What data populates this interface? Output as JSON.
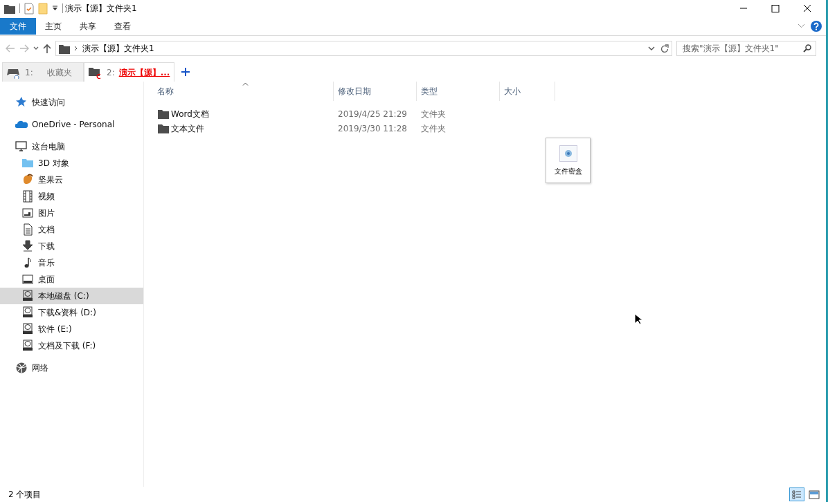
{
  "window": {
    "title": "演示【源】文件夹1"
  },
  "ribbon": {
    "tabs": [
      {
        "label": "文件",
        "selected": true
      },
      {
        "label": "主页",
        "selected": false
      },
      {
        "label": "共享",
        "selected": false
      },
      {
        "label": "查看",
        "selected": false
      }
    ]
  },
  "address": {
    "path": [
      "演示【源】文件夹1"
    ],
    "search": {
      "placeholder": "搜索\"演示【源】文件夹1\""
    }
  },
  "browser_tabs": [
    {
      "number": "1:",
      "label": "收藏夹",
      "selected": false
    },
    {
      "number": "2:",
      "label": "演示【源】...",
      "selected": true
    }
  ],
  "sidebar": {
    "items": [
      {
        "kind": "star",
        "label": "快速访问",
        "selected": false
      },
      {
        "kind": "cloud",
        "label": "OneDrive - Personal",
        "selected": false
      },
      {
        "kind": "pc",
        "label": "这台电脑",
        "selected": false,
        "children": [
          {
            "kind": "objects",
            "label": "3D 对象",
            "selected": false
          },
          {
            "kind": "nut",
            "label": "坚果云",
            "selected": false
          },
          {
            "kind": "video",
            "label": "视频",
            "selected": false
          },
          {
            "kind": "picture",
            "label": "图片",
            "selected": false
          },
          {
            "kind": "document",
            "label": "文档",
            "selected": false
          },
          {
            "kind": "download",
            "label": "下载",
            "selected": false
          },
          {
            "kind": "music",
            "label": "音乐",
            "selected": false
          },
          {
            "kind": "desktop",
            "label": "桌面",
            "selected": false
          },
          {
            "kind": "drive",
            "label": "本地磁盘 (C:)",
            "selected": true
          },
          {
            "kind": "drive",
            "label": "下载&资料 (D:)",
            "selected": false
          },
          {
            "kind": "drive",
            "label": "软件 (E:)",
            "selected": false
          },
          {
            "kind": "drive",
            "label": "文档及下载 (F:)",
            "selected": false
          }
        ]
      },
      {
        "kind": "network",
        "label": "网络",
        "selected": false
      }
    ]
  },
  "table": {
    "columns": [
      {
        "label": "名称",
        "sorted": true
      },
      {
        "label": "修改日期",
        "sorted": false
      },
      {
        "label": "类型",
        "sorted": false
      },
      {
        "label": "大小",
        "sorted": false
      }
    ],
    "rows": [
      {
        "name": "Word文档",
        "modified": "2019/4/25 21:29",
        "type": "文件夹"
      },
      {
        "name": "文本文件",
        "modified": "2019/3/30 11:28",
        "type": "文件夹"
      }
    ]
  },
  "widget": {
    "label": "文件密盒"
  },
  "status_bar": {
    "count": "2 个项目",
    "views": [
      {
        "kind": "details",
        "selected": true
      },
      {
        "kind": "thumbnails",
        "selected": false
      }
    ]
  }
}
